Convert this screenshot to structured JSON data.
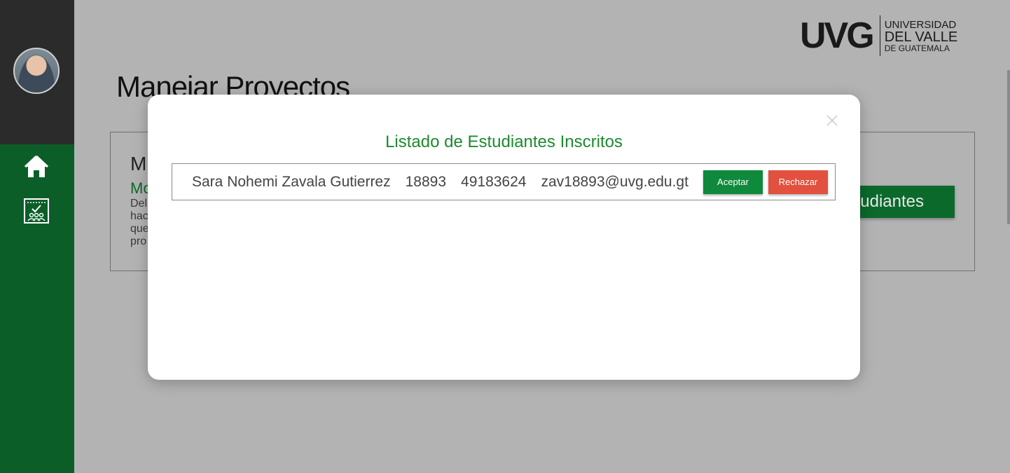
{
  "sidebar": {
    "avatar_alt": "",
    "items": [
      {
        "icon": "home-icon"
      },
      {
        "icon": "project-board-icon"
      }
    ]
  },
  "logo": {
    "mark": "UVG",
    "line1": "UNIVERSIDAD",
    "line2": "DEL VALLE",
    "line3": "DE GUATEMALA"
  },
  "page": {
    "title": "Manejar Proyectos",
    "card": {
      "title": "M",
      "subtitle": "Mo",
      "description": "Del hac que pro",
      "students_button_label": "tudiantes"
    }
  },
  "modal": {
    "title": "Listado de Estudiantes Inscritos",
    "close_icon": "close-icon",
    "students": [
      {
        "name": "Sara Nohemi Zavala Gutierrez",
        "carnet": "18893",
        "phone": "49183624",
        "email": "zav18893@uvg.edu.gt",
        "accept_label": "Aceptar",
        "reject_label": "Rechazar"
      }
    ]
  },
  "colors": {
    "sidebar_green": "#0b5e28",
    "sidebar_dark": "#2b2b2b",
    "title_green": "#1e8a2e",
    "accept_green": "#0f8a3c",
    "reject_red": "#e2503f",
    "overlay_gray": "#b3b3b3"
  }
}
